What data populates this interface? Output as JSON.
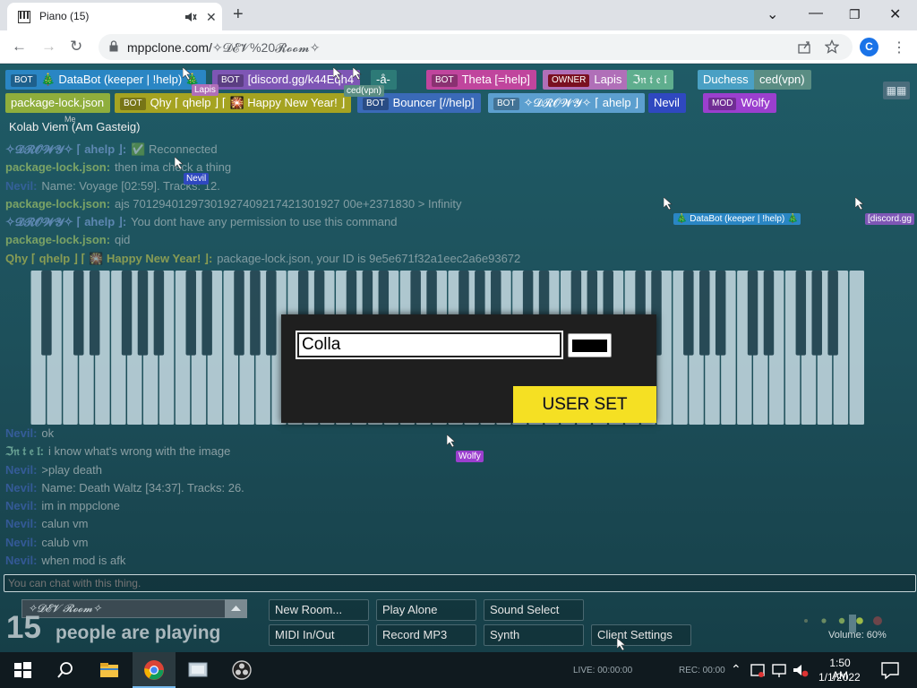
{
  "browser": {
    "tab_title": "Piano (15)",
    "url_host": "mppclone.com/",
    "url_path": "✧𝓓𝓔𝓥%20𝓡𝓸𝓸𝓶✧",
    "profile_initial": "C"
  },
  "users_row1": [
    {
      "tag": "BOT",
      "name": "🎄 DataBot (keeper | !help) 🎄",
      "color": "#2a86c4"
    },
    {
      "tag": "BOT",
      "name": "[discord.gg/k44Eqh4",
      "color": "#7e56b5"
    },
    {
      "tag": "",
      "name": "-å-",
      "color": "#2d7a77"
    },
    {
      "tag": "BOT",
      "name": "Theta [=help]",
      "color": "#c0459d"
    },
    {
      "tag": "OWNER",
      "name": "Lapis",
      "color": "#b06fb8"
    },
    {
      "tag": "",
      "name": "ℑ𝔫 𝔱 𝔢 𝔩",
      "color": "#5fae8e"
    },
    {
      "tag": "",
      "name": "Duchess",
      "color": "#4aa0c4"
    },
    {
      "tag": "",
      "name": "ced(vpn)",
      "color": "#5a8d83"
    }
  ],
  "users_row2": [
    {
      "tag": "",
      "name": "package-lock.json",
      "color": "#8fae3c"
    },
    {
      "tag": "BOT",
      "name": "Qhy ⌈ qhelp ⌋ ⌈ 🎇 Happy New Year! ⌋",
      "color": "#a5a321"
    },
    {
      "tag": "BOT",
      "name": "Bouncer [//help]",
      "color": "#3a6ab8"
    },
    {
      "tag": "BOT",
      "name": "✧𝓓𝓡𝓞𝓦𝓨✧ ⌈ ahelp ⌋",
      "color": "#5c9fcf"
    },
    {
      "tag": "",
      "name": "Nevil",
      "color": "#2f48c0"
    },
    {
      "tag": "MOD",
      "name": "Wolfy",
      "color": "#9b3fce"
    }
  ],
  "room_title": "Kolab Viem (Am Gasteig)",
  "me_label": "Me",
  "chat_top": [
    {
      "name": "✧𝓓𝓡𝓞𝓦𝓨✧ ⌈ ahelp ⌋:",
      "msg": "✅ Reconnected",
      "color": "#9ab7ff"
    },
    {
      "name": "package-lock.json:",
      "msg": "then ima check a thing",
      "color": "#d5ee6a"
    },
    {
      "name": "Nevil:",
      "msg": "Name: Voyage [02:59]. Tracks: 12.",
      "color": "#4a6ad0"
    },
    {
      "name": "package-lock.json:",
      "msg": "ajs 70129401297301927409217421301927 00e+2371830 > Infinity",
      "color": "#d5ee6a"
    },
    {
      "name": "✧𝓓𝓡𝓞𝓦𝓨✧ ⌈ ahelp ⌋:",
      "msg": "You dont have any permission to use this command",
      "color": "#9ab7ff"
    },
    {
      "name": "package-lock.json:",
      "msg": "qid",
      "color": "#d5ee6a"
    },
    {
      "name": "Qhy ⌈ qhelp ⌋ ⌈ 🎇 Happy New Year! ⌋:",
      "msg": "package-lock.json, your ID is 9e5e671f32a1eec2a6e93672",
      "color": "#f0e24a"
    }
  ],
  "chat_bottom": [
    {
      "name": "Nevil:",
      "msg": "ok",
      "color": "#4a6ad0"
    },
    {
      "name": "ℑ𝔫 𝔱 𝔢 𝔩:",
      "msg": "i know what's wrong with the image",
      "color": "#a9e8c8"
    },
    {
      "name": "Nevil:",
      "msg": ">play death",
      "color": "#4a6ad0"
    },
    {
      "name": "Nevil:",
      "msg": "Name: Death Waltz [34:37]. Tracks: 26.",
      "color": "#4a6ad0"
    },
    {
      "name": "Nevil:",
      "msg": "im in mppclone",
      "color": "#4a6ad0"
    },
    {
      "name": "Nevil:",
      "msg": "calun vm",
      "color": "#4a6ad0"
    },
    {
      "name": "Nevil:",
      "msg": "calub vm",
      "color": "#4a6ad0"
    },
    {
      "name": "Nevil:",
      "msg": "when mod is afk",
      "color": "#4a6ad0"
    }
  ],
  "cursor_labels": {
    "lapis": "Lapis",
    "ced": "ced(vpn)",
    "nevil": "Nevil",
    "wolfy": "Wolfy",
    "databot": "🎄 DataBot (keeper | !help) 🎄",
    "discord": "[discord.gg"
  },
  "dialog": {
    "name_value": "Colla",
    "button_label": "USER SET",
    "color_value": "#000000"
  },
  "chat_input_placeholder": "You can chat with this thing.",
  "room_select_value": "✧𝓓𝓔𝓥 𝓡𝓸𝓸𝓶✧",
  "people": {
    "count": "15",
    "text": "people are playing"
  },
  "buttons": {
    "new_room": "New Room...",
    "play_alone": "Play Alone",
    "sound_select": "Sound Select",
    "midi": "MIDI In/Out",
    "record": "Record MP3",
    "synth": "Synth",
    "client_settings": "Client Settings"
  },
  "volume_label": "Volume: 60%",
  "volume_level": 0.6,
  "taskbar": {
    "time": "1:50 AM",
    "date": "1/1/2022",
    "live": "LIVE: 00:00:00",
    "rec": "REC: 00:00"
  },
  "icons": {
    "favicon": "piano-icon",
    "audio": "speaker-icon",
    "lock": "lock-icon",
    "share": "share-icon",
    "star": "star-icon"
  }
}
